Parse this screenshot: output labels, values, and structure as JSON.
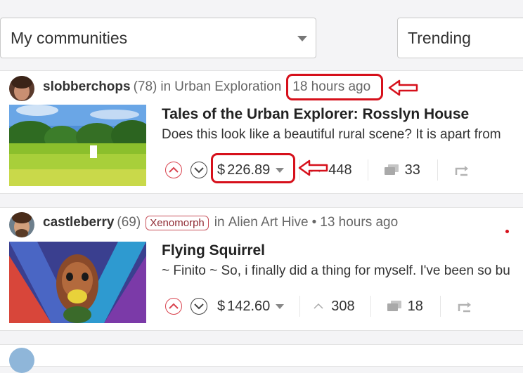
{
  "filters": {
    "community": "My communities",
    "sort": "Trending"
  },
  "posts": [
    {
      "author": "slobberchops",
      "reputation": "(78)",
      "in_label": "in",
      "community": "Urban Exploration",
      "time": "18 hours ago",
      "title": "Tales of the Urban Explorer: Rosslyn House",
      "summary": "Does this look like a beautiful rural scene? It is apart from",
      "currency": "$",
      "payout": "226.89",
      "votes": "448",
      "comments": "33"
    },
    {
      "author": "castleberry",
      "reputation": "(69)",
      "tag": "Xenomorph",
      "in_label": "in",
      "community": "Alien Art Hive",
      "dot": "•",
      "time": "13 hours ago",
      "title": "Flying Squirrel",
      "summary": "~ Finito ~ So, i finally did a thing for myself. I've been so bu",
      "currency": "$",
      "payout": "142.60",
      "votes": "308",
      "comments": "18"
    }
  ],
  "colors": {
    "annotation": "#d6101b",
    "upvote": "#d9434e",
    "tag": "#c7505a"
  }
}
